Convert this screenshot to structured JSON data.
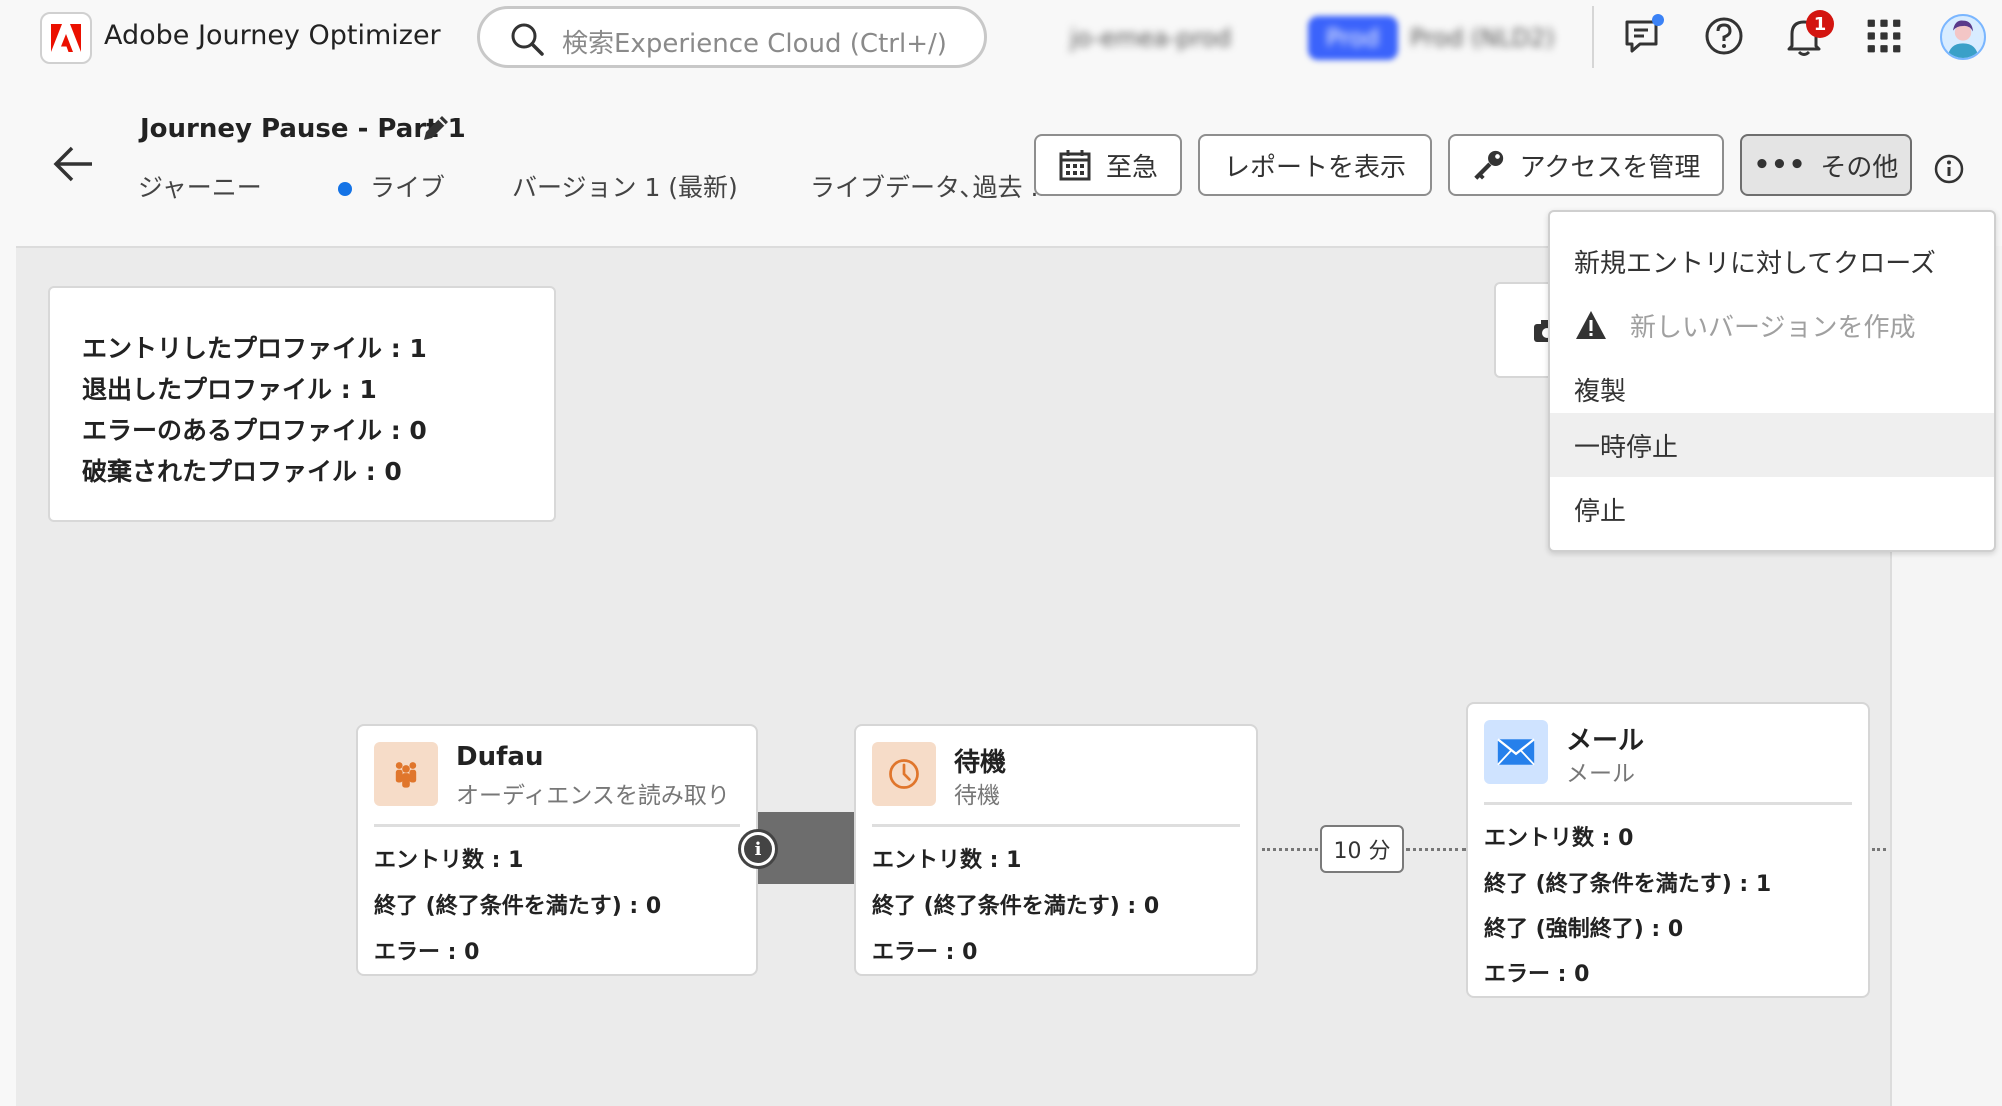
{
  "app": {
    "name": "Adobe Journey Optimizer"
  },
  "search": {
    "placeholder": "検索Experience Cloud (Ctrl+/)"
  },
  "org": {
    "sandbox_name": "jo-emea-prod",
    "env_badge": "Prod",
    "env_label": "Prod (NLD2)"
  },
  "notifications": {
    "count": "1"
  },
  "journey": {
    "title": "Journey Pause - Part 1",
    "type_label": "ジャーニー",
    "status": "ライブ",
    "version": "バージョン 1 (最新)",
    "data_mode": "ライブデータ､過去 ...",
    "status_color": "#1473e6"
  },
  "toolbar": {
    "urgent_label": "至急",
    "report_label": "レポートを表示",
    "access_label": "アクセスを管理",
    "more_label": "その他"
  },
  "more_menu": {
    "items": [
      {
        "label": "新規エントリに対してクローズ",
        "disabled": false
      },
      {
        "label": "新しいバージョンを作成",
        "disabled": true,
        "icon": "alert-icon"
      },
      {
        "label": "複製",
        "disabled": false
      },
      {
        "label": "一時停止",
        "disabled": false,
        "highlighted": true
      },
      {
        "label": "停止",
        "disabled": false
      }
    ]
  },
  "stats": {
    "entered": "エントリしたプロファイル : 1",
    "exited": "退出したプロファイル : 1",
    "errors": "エラーのあるプロファイル : 0",
    "discarded": "破棄されたプロファイル : 0"
  },
  "nodes": [
    {
      "name": "Dufau",
      "subtitle": "オーディエンスを読み取り",
      "icon": "audience-icon",
      "rows": [
        "エントリ数 : 1",
        "終了 (終了条件を満たす) : 0",
        "エラー : 0"
      ]
    },
    {
      "name": "待機",
      "subtitle": "待機",
      "icon": "clock-icon",
      "rows": [
        "エントリ数 : 1",
        "終了 (終了条件を満たす) : 0",
        "エラー : 0"
      ]
    },
    {
      "name": "メール",
      "subtitle": "メール",
      "icon": "email-icon",
      "rows": [
        "エントリ数 : 0",
        "終了 (終了条件を満たす) : 1",
        "終了 (強制終了) : 0",
        "エラー : 0"
      ]
    }
  ],
  "wait_duration": "10 分",
  "colors": {
    "brand": "#eb1000",
    "accent": "#1473e6",
    "activity_icon_bg": "#f6dcc8",
    "email_icon_bg": "#cfe3ff"
  }
}
